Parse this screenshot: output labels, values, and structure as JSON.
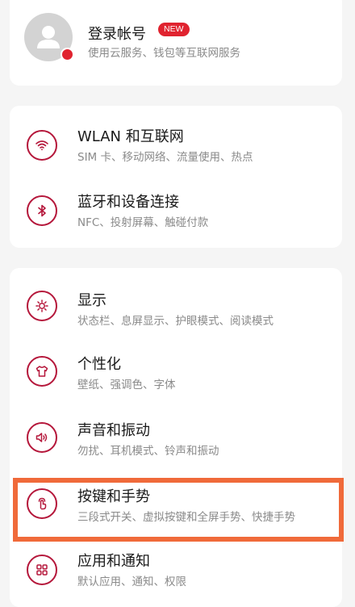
{
  "account": {
    "title": "登录帐号",
    "badge": "NEW",
    "subtitle": "使用云服务、钱包等互联网服务",
    "avatar_icon": "user-avatar-icon"
  },
  "network": {
    "items": [
      {
        "icon": "wifi-icon",
        "title": "WLAN 和互联网",
        "subtitle": "SIM 卡、移动网络、流量使用、热点"
      },
      {
        "icon": "bluetooth-icon",
        "title": "蓝牙和设备连接",
        "subtitle": "NFC、投射屏幕、触碰付款"
      }
    ]
  },
  "system": {
    "items": [
      {
        "icon": "brightness-icon",
        "title": "显示",
        "subtitle": "状态栏、息屏显示、护眼模式、阅读模式"
      },
      {
        "icon": "tshirt-icon",
        "title": "个性化",
        "subtitle": "壁纸、强调色、字体"
      },
      {
        "icon": "speaker-icon",
        "title": "声音和振动",
        "subtitle": "勿扰、耳机模式、铃声和振动"
      },
      {
        "icon": "gesture-icon",
        "title": "按键和手势",
        "subtitle": "三段式开关、虚拟按键和全屏手势、快捷手势"
      },
      {
        "icon": "apps-grid-icon",
        "title": "应用和通知",
        "subtitle": "默认应用、通知、权限"
      }
    ]
  },
  "colors": {
    "accent": "#b5173b",
    "badge": "#e0232f",
    "highlight": "#f06a3a",
    "background": "#f5f5f5"
  }
}
